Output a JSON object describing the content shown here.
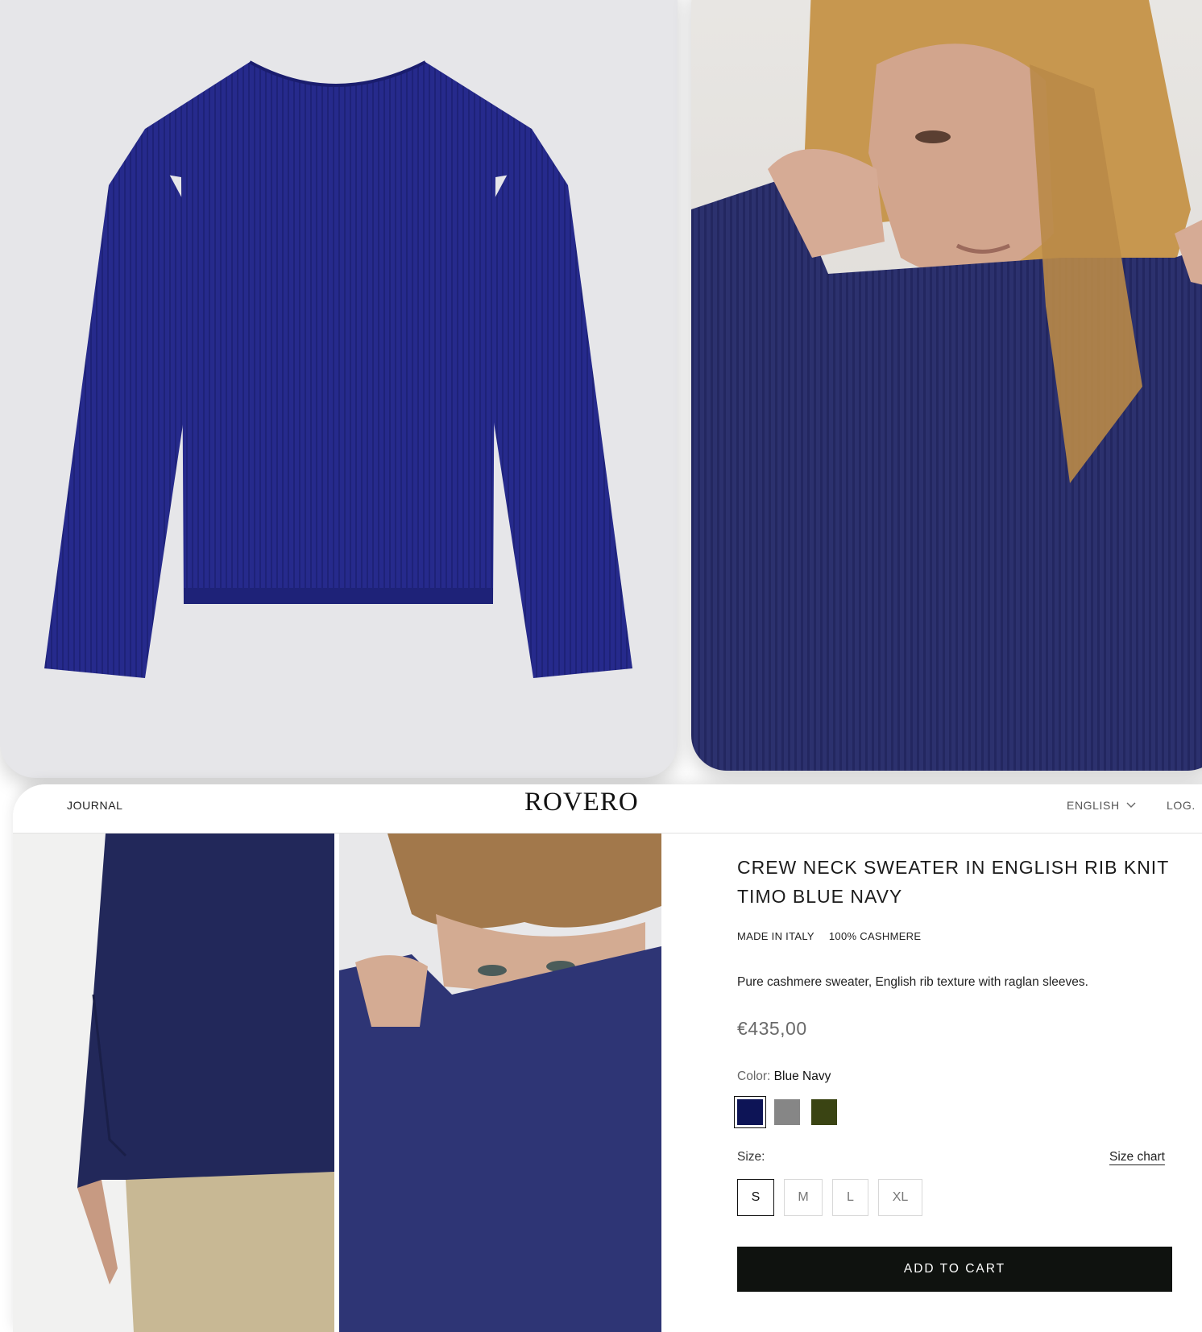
{
  "nav": {
    "journal": "JOURNAL",
    "logo": "ROVERO",
    "language": "ENGLISH",
    "login": "LOG."
  },
  "images": {
    "product_flat": "navy-sweater-flat",
    "model_top": "model-wearing-sweater",
    "gallery_side": "sweater-side-view",
    "gallery_face": "model-pulling-collar"
  },
  "product": {
    "title": "CREW NECK SWEATER IN ENGLISH RIB KNIT TIMO BLUE NAVY",
    "tags": [
      "MADE IN ITALY",
      "100% CASHMERE"
    ],
    "description": "Pure cashmere sweater, English rib texture with raglan sleeves.",
    "price": "€435,00",
    "color_label": "Color:",
    "color_value": "Blue Navy",
    "colors": [
      {
        "name": "blue-navy",
        "hex": "#0d1456",
        "selected": true
      },
      {
        "name": "grey",
        "hex": "#868686",
        "selected": false
      },
      {
        "name": "olive",
        "hex": "#3a4413",
        "selected": false
      }
    ],
    "size_label": "Size:",
    "size_chart": "Size chart",
    "sizes": [
      "S",
      "M",
      "L",
      "XL"
    ],
    "selected_size": "S",
    "add_to_cart": "ADD TO CART"
  },
  "colors": {
    "sweater_navy": "#262a8c",
    "button_bg": "#0f120f",
    "price_gray": "#6a6a6a"
  }
}
